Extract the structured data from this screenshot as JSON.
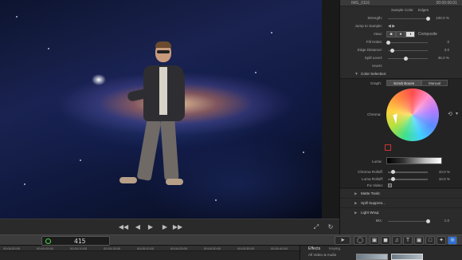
{
  "inspector": {
    "clip_name": "IMG_0116",
    "clip_timecode": "00:00:00:01",
    "top_labels": [
      "Sample Color",
      "Edges"
    ],
    "rows": {
      "strength": {
        "label": "Strength:",
        "value": "100.0 %",
        "level": 1.0
      },
      "jump_to_sample": {
        "label": "Jump to Sample:"
      },
      "view": {
        "label": "View:",
        "composite": "Composite"
      },
      "fill_holes": {
        "label": "Fill Holes:",
        "value": "0",
        "level": 0.0
      },
      "edge_distance": {
        "label": "Edge Distance:",
        "value": "3.0",
        "level": 0.1
      },
      "spill_level": {
        "label": "Spill Level:",
        "value": "45.0 %",
        "level": 0.45
      },
      "invert": {
        "label": "Invert:"
      }
    },
    "color_selection": {
      "title": "Color Selection:",
      "graph_label": "Graph:",
      "tabs": [
        "Scrub Boxes",
        "Manual"
      ],
      "chroma_label": "Chroma:",
      "luma_label": "Luma:",
      "chroma_rolloff": {
        "label": "Chroma Rolloff:",
        "value": "10.0 %",
        "level": 0.1
      },
      "luma_rolloff": {
        "label": "Luma Rolloff:",
        "value": "10.0 %",
        "level": 0.1
      },
      "fix_video": {
        "label": "Fix Video:"
      }
    },
    "sections": [
      "Matte Tools:",
      "Spill Suppres...",
      "Light Wrap:"
    ],
    "mix": {
      "label": "Mix:",
      "value": "1.0",
      "level": 1.0
    }
  },
  "toolbar": {
    "timecode": "415"
  },
  "timeline": {
    "marks": [
      "00:00:00:00",
      "00:00:05:00",
      "00:00:10:00",
      "00:00:15:00",
      "00:00:20:00",
      "00:00:25:00",
      "00:00:30:00",
      "00:00:35:00",
      "00:00:40:00"
    ]
  },
  "effects": {
    "title": "Effects",
    "keying_label": "Keying",
    "category": "All Video & Audio"
  }
}
